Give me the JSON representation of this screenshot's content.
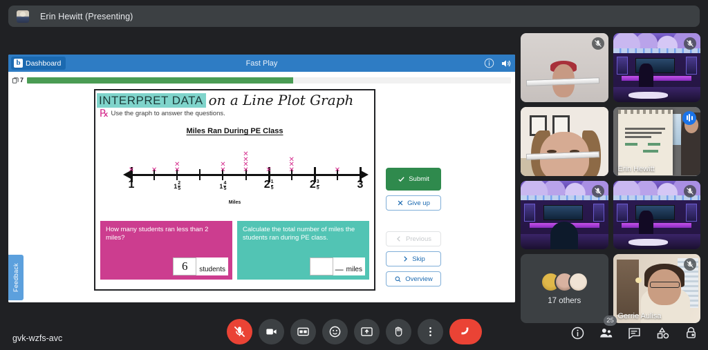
{
  "meeting": {
    "presenter_label": "Erin Hewitt (Presenting)",
    "code": "gvk-wzfs-avc",
    "participant_count": "25",
    "avatar_icon": "presenter-avatar"
  },
  "app": {
    "dashboard_label": "Dashboard",
    "logo_letter": "b",
    "title": "Fast Play",
    "info_icon": "info-icon",
    "sound_icon": "speaker-icon",
    "cards_count": "7",
    "progress_percent": 55,
    "feedback_label": "Feedback",
    "feedback_icon": "external-link-icon"
  },
  "worksheet": {
    "title_highlight": "INTERPRET DATA",
    "title_script": "on a Line Plot Graph",
    "instruction": "Use the graph to answer the questions.",
    "questions": [
      {
        "text": "How many students ran less than 2 miles?",
        "answer": "6",
        "unit": "students",
        "color": "#cc3d8f"
      },
      {
        "text": "Calculate the total number of miles the students ran during PE class.",
        "answer": "",
        "unit": "miles",
        "color": "#52c4b4"
      }
    ]
  },
  "chart_data": {
    "type": "line_plot",
    "title": "Miles Ran During PE Class",
    "xlabel": "Miles",
    "ylabel": "",
    "grid": false,
    "marker": "x",
    "marker_color": "#d6308f",
    "axis_range": [
      "1",
      "3"
    ],
    "tick_labels": [
      "1",
      "",
      "1 2/5",
      "",
      "1 4/5",
      "",
      "2 1/5",
      "",
      "2 3/5",
      "",
      "3"
    ],
    "major_labels": [
      "1",
      "1 2/5",
      "1 4/5",
      "2 1/5",
      "2 3/5",
      "3"
    ],
    "x": [
      "1",
      "1 1/5",
      "1 2/5",
      "1 3/5",
      "1 4/5",
      "2",
      "2 1/5",
      "2 2/5",
      "2 3/5",
      "2 4/5",
      "3"
    ],
    "values": [
      1,
      1,
      2,
      0,
      2,
      4,
      1,
      3,
      0,
      1,
      0
    ],
    "total_students": 15,
    "ticks": [
      {
        "label_whole": "1",
        "label_num": "",
        "label_den": "",
        "big": true,
        "count": 1
      },
      {
        "label_whole": "",
        "label_num": "",
        "label_den": "",
        "big": false,
        "count": 1
      },
      {
        "label_whole": "1",
        "label_num": "2",
        "label_den": "5",
        "big": false,
        "count": 2
      },
      {
        "label_whole": "",
        "label_num": "",
        "label_den": "",
        "big": false,
        "count": 0
      },
      {
        "label_whole": "1",
        "label_num": "4",
        "label_den": "5",
        "big": false,
        "count": 2
      },
      {
        "label_whole": "",
        "label_num": "",
        "label_den": "",
        "big": false,
        "count": 4
      },
      {
        "label_whole": "2",
        "label_num": "1",
        "label_den": "5",
        "big": true,
        "count": 1
      },
      {
        "label_whole": "",
        "label_num": "",
        "label_den": "",
        "big": false,
        "count": 3
      },
      {
        "label_whole": "2",
        "label_num": "3",
        "label_den": "5",
        "big": true,
        "count": 0
      },
      {
        "label_whole": "",
        "label_num": "",
        "label_den": "",
        "big": false,
        "count": 1
      },
      {
        "label_whole": "3",
        "label_num": "",
        "label_den": "",
        "big": true,
        "count": 0
      }
    ]
  },
  "actions": {
    "submit": "Submit",
    "give_up": "Give up",
    "previous": "Previous",
    "skip": "Skip",
    "overview": "Overview"
  },
  "tiles": [
    {
      "name": "",
      "scene": "plain",
      "muted": true,
      "speaking": false
    },
    {
      "name": "",
      "scene": "room",
      "muted": true,
      "speaking": false
    },
    {
      "name": "",
      "scene": "girl",
      "muted": false,
      "speaking": false
    },
    {
      "name": "Erin Hewitt",
      "scene": "board",
      "muted": false,
      "speaking": true
    },
    {
      "name": "",
      "scene": "room-dark",
      "muted": true,
      "speaking": false
    },
    {
      "name": "",
      "scene": "room",
      "muted": true,
      "speaking": false
    },
    {
      "name": "17 others",
      "scene": "others",
      "muted": false,
      "speaking": false
    },
    {
      "name": "Gerrie Aulisa",
      "scene": "woman",
      "muted": true,
      "speaking": false
    }
  ],
  "controls": {
    "mic": "microphone-muted",
    "camera": "camera-off",
    "captions": "closed-captions",
    "reactions": "emoji-reactions",
    "present": "present-screen",
    "hand": "raise-hand",
    "more": "more-options",
    "hangup": "leave-call",
    "info": "meeting-details",
    "people": "participants",
    "chat": "chat",
    "activities": "activities",
    "host": "host-controls"
  },
  "colors": {
    "app_header": "#2e7cc4",
    "progress": "#4a9c54",
    "submit": "#2f8a4d",
    "accent_link": "#1b69b0",
    "question_pink": "#cc3d8f",
    "question_teal": "#52c4b4",
    "marker": "#d6308f",
    "danger": "#ea4335",
    "speaking_border": "#8ab4f8"
  }
}
